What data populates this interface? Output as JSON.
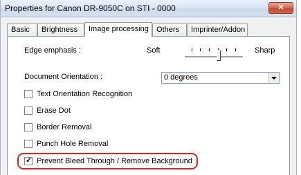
{
  "window": {
    "title": "Properties for Canon DR-9050C on STI - 0000",
    "close_glyph": "✕"
  },
  "tabs": [
    {
      "label": "Basic",
      "active": false
    },
    {
      "label": "Brightness",
      "active": false
    },
    {
      "label": "Image processing",
      "active": true
    },
    {
      "label": "Others",
      "active": false
    },
    {
      "label": "Imprinter/Addon",
      "active": false
    }
  ],
  "edge_emphasis": {
    "label": "Edge emphasis :",
    "min_label": "Soft",
    "max_label": "Sharp",
    "tick_count": 7,
    "selected_tick_index": 4
  },
  "orientation": {
    "label": "Document Orientation :",
    "selected_value": "0 degrees"
  },
  "options": [
    {
      "label": "Text Orientation Recognition",
      "checked": false
    },
    {
      "label": "Erase Dot",
      "checked": false
    },
    {
      "label": "Border Removal",
      "checked": false
    },
    {
      "label": "Punch Hole Removal",
      "checked": false
    },
    {
      "label": "Prevent Bleed Through / Remove Background",
      "checked": true,
      "highlighted": true
    }
  ],
  "colors": {
    "highlight": "#e02020",
    "close_button": "#c24a2f"
  }
}
